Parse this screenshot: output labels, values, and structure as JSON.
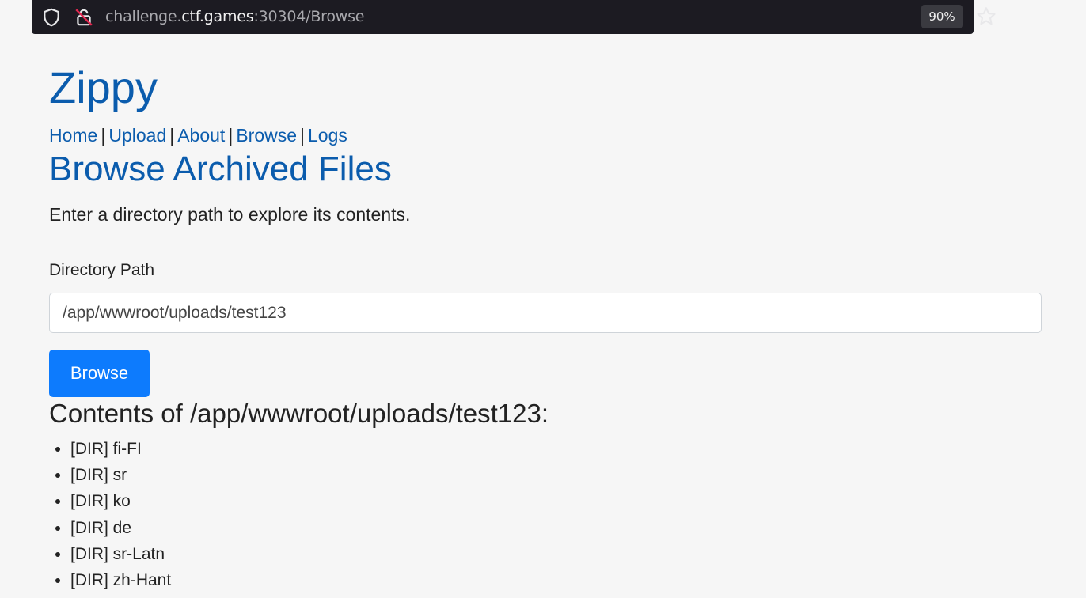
{
  "browser": {
    "url_prefix": "challenge.",
    "url_domain": "ctf.games",
    "url_suffix": ":30304/Browse",
    "zoom": "90%"
  },
  "site": {
    "title": "Zippy",
    "nav": [
      "Home",
      "Upload",
      "About",
      "Browse",
      "Logs"
    ],
    "nav_separator": "|"
  },
  "main": {
    "heading": "Browse Archived Files",
    "intro": "Enter a directory path to explore its contents.",
    "field_label": "Directory Path",
    "path_value": "/app/wwwroot/uploads/test123",
    "button_label": "Browse",
    "contents_heading": "Contents of /app/wwwroot/uploads/test123:",
    "entries": [
      "[DIR] fi-FI",
      "[DIR] sr",
      "[DIR] ko",
      "[DIR] de",
      "[DIR] sr-Latn",
      "[DIR] zh-Hant"
    ]
  },
  "icons": {
    "shield": "shield-icon",
    "lock": "insecure-lock-icon",
    "star": "star-bookmark-icon"
  },
  "colors": {
    "link": "#0b5cad",
    "button": "#0d7bfd",
    "page_bg": "#f6f6f6",
    "urlbar_bg": "#1c1b22"
  }
}
